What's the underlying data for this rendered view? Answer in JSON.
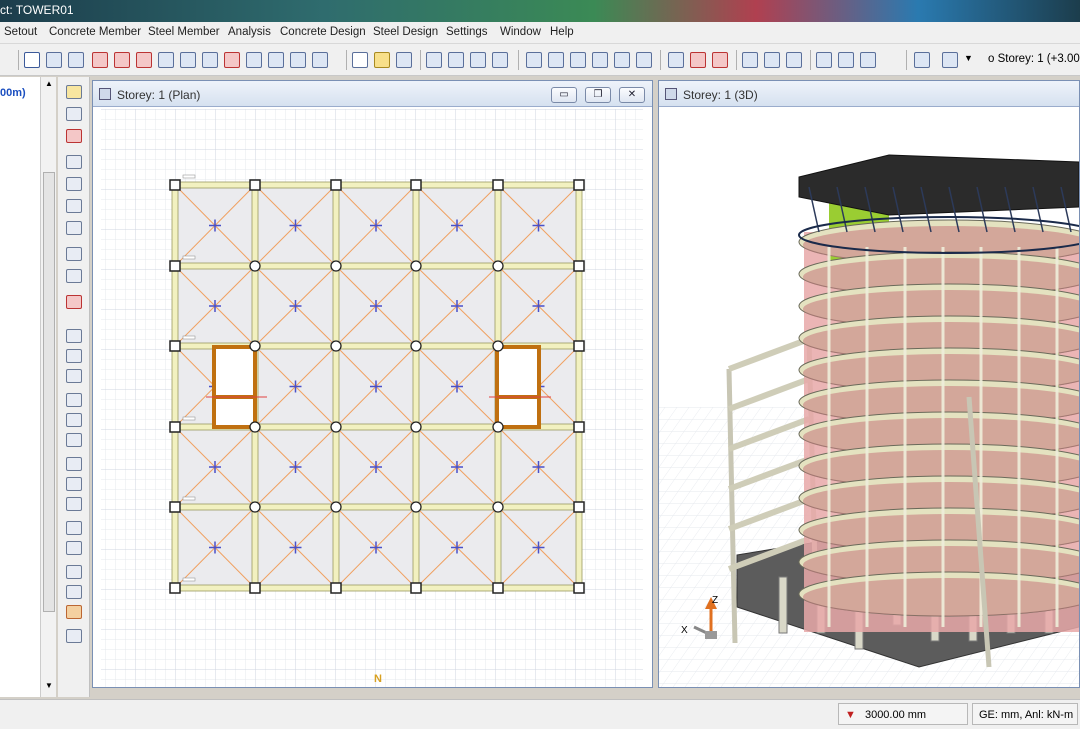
{
  "app": {
    "title": "ct: TOWER01"
  },
  "menu": [
    "Setout",
    "Concrete Member",
    "Steel Member",
    "Analysis",
    "Concrete Design",
    "Steel Design",
    "Settings",
    "Window",
    "Help"
  ],
  "toolbar": {
    "storey_label": "o Storey: 1 (+3.00"
  },
  "tree": {
    "visible_text": "00m)"
  },
  "plan_window": {
    "title": "Storey: 1 (Plan)",
    "north_label": "N",
    "buttons": {
      "minimize": "▭",
      "restore": "❐",
      "close": "✕"
    }
  },
  "view3d_window": {
    "title": "Storey: 1 (3D)",
    "axis_z": "Z",
    "axis_x": "X"
  },
  "statusbar": {
    "elevation": "3000.00 mm",
    "units": "GE: mm,  Anl: kN-m"
  },
  "colors": {
    "accent_window": "#7a90b4",
    "beam": "#e8e7a6",
    "wall": "#c58a18",
    "core_green": "#9acd32",
    "slab_red": "#e8a0a0"
  }
}
